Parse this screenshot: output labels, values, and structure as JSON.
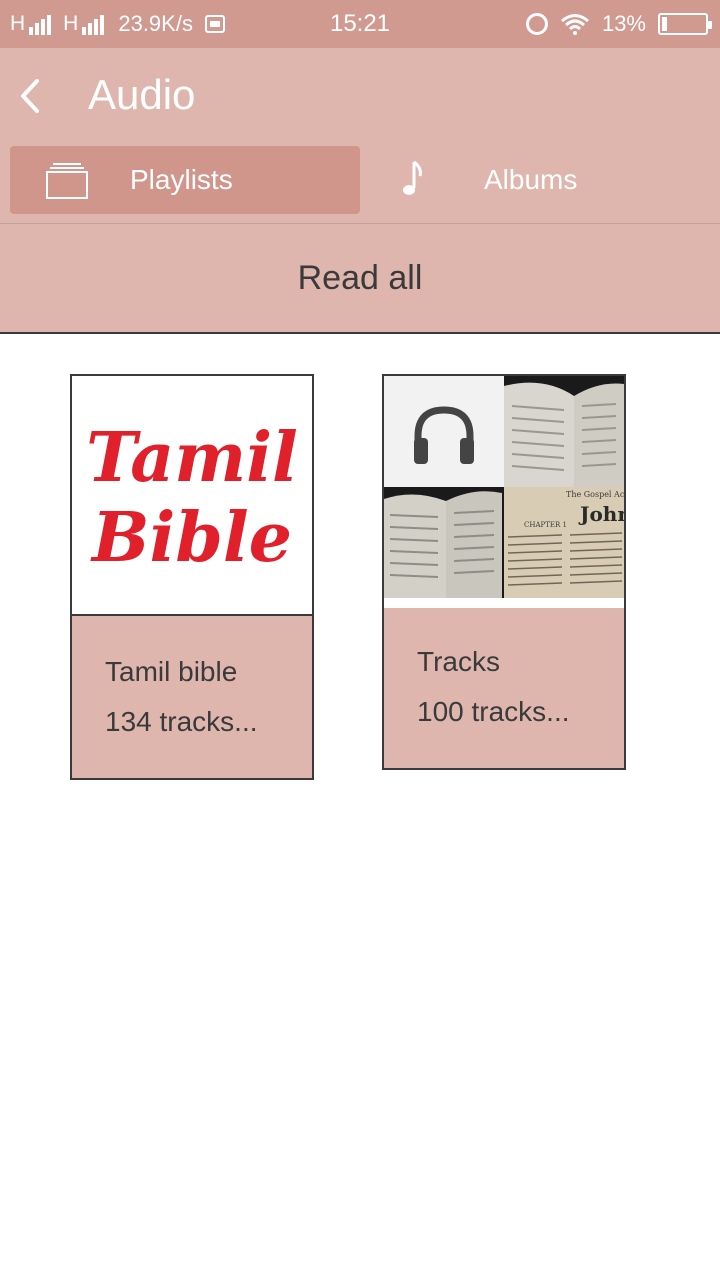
{
  "status_bar": {
    "net1": "H",
    "net2": "H",
    "speed": "23.9K/s",
    "time": "15:21",
    "battery": "13%"
  },
  "app_bar": {
    "title": "Audio"
  },
  "tabs": [
    {
      "label": "Playlists",
      "icon": "folder-stack-icon",
      "selected": true
    },
    {
      "label": "Albums",
      "icon": "music-note-icon",
      "selected": false
    }
  ],
  "read_all": {
    "label": "Read all"
  },
  "playlists": [
    {
      "art_text_line1": "Tamil",
      "art_text_line2": "Bible",
      "title": "Tamil bible",
      "subtitle": "134 tracks..."
    },
    {
      "art_icon": "headphones-icon",
      "art_book_heading": "The Gospel According to",
      "art_book_name": "John",
      "art_chapter": "CHAPTER 1",
      "title": "Tracks",
      "subtitle": "100 tracks..."
    }
  ],
  "colors": {
    "status_bar": "#d19a90",
    "app_bar": "#deb6ae",
    "tab_selected": "#d0958b",
    "logo_red": "#e0202a",
    "text_dark": "#3a3a3a"
  }
}
